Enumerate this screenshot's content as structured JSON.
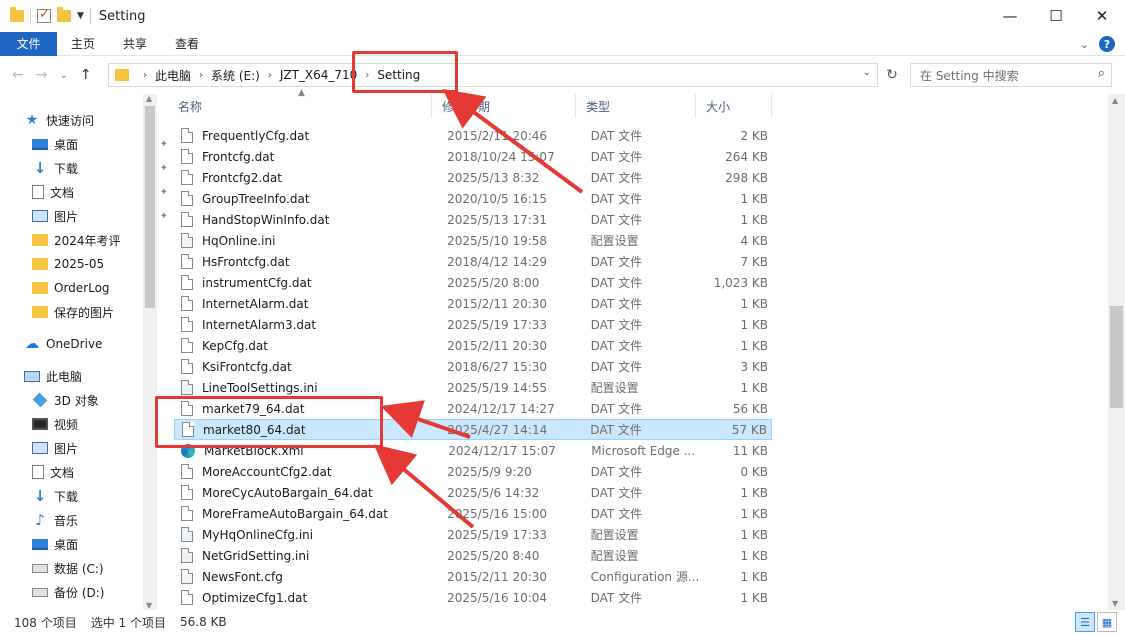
{
  "window": {
    "title": "Setting",
    "minimize": "—",
    "maximize": "☐",
    "close": "✕"
  },
  "ribbon": {
    "tabs": [
      "文件",
      "主页",
      "共享",
      "查看"
    ],
    "collapse_glyph": "⌄",
    "help_glyph": "?"
  },
  "address": {
    "back": "←",
    "forward": "→",
    "recent": "⌄",
    "up": "↑",
    "breadcrumb": [
      "此电脑",
      "系统 (E:)",
      "JZT_X64_710",
      "Setting"
    ],
    "search_placeholder": "在 Setting 中搜索"
  },
  "nav": {
    "items": [
      {
        "label": "快速访问",
        "icon": "star-icon"
      },
      {
        "label": "桌面",
        "icon": "desktop-icon",
        "pinned": true
      },
      {
        "label": "下载",
        "icon": "download-icon",
        "pinned": true
      },
      {
        "label": "文档",
        "icon": "document-icon",
        "pinned": true
      },
      {
        "label": "图片",
        "icon": "picture-icon",
        "pinned": true
      },
      {
        "label": "2024年考评",
        "icon": "folder-icon"
      },
      {
        "label": "2025-05",
        "icon": "folder-icon"
      },
      {
        "label": "OrderLog",
        "icon": "folder-icon"
      },
      {
        "label": "保存的图片",
        "icon": "folder-icon"
      },
      {
        "label": "OneDrive",
        "icon": "cloud-icon"
      },
      {
        "label": "此电脑",
        "icon": "computer-icon"
      },
      {
        "label": "3D 对象",
        "icon": "cube-icon"
      },
      {
        "label": "视频",
        "icon": "video-icon"
      },
      {
        "label": "图片",
        "icon": "picture-icon"
      },
      {
        "label": "文档",
        "icon": "document-icon"
      },
      {
        "label": "下载",
        "icon": "download-icon"
      },
      {
        "label": "音乐",
        "icon": "music-icon"
      },
      {
        "label": "桌面",
        "icon": "desktop-icon"
      },
      {
        "label": "数据 (C:)",
        "icon": "drive-icon"
      },
      {
        "label": "备份 (D:)",
        "icon": "drive-icon"
      }
    ]
  },
  "columns": {
    "name": "名称",
    "date": "修改日期",
    "type": "类型",
    "size": "大小"
  },
  "files": [
    {
      "name": "FrequentlyCfg.dat",
      "date": "2015/2/11 20:46",
      "type": "DAT 文件",
      "size": "2 KB",
      "icon": "file"
    },
    {
      "name": "Frontcfg.dat",
      "date": "2018/10/24 15:07",
      "type": "DAT 文件",
      "size": "264 KB",
      "icon": "file"
    },
    {
      "name": "Frontcfg2.dat",
      "date": "2025/5/13 8:32",
      "type": "DAT 文件",
      "size": "298 KB",
      "icon": "file"
    },
    {
      "name": "GroupTreeInfo.dat",
      "date": "2020/10/5 16:15",
      "type": "DAT 文件",
      "size": "1 KB",
      "icon": "file"
    },
    {
      "name": "HandStopWinInfo.dat",
      "date": "2025/5/13 17:31",
      "type": "DAT 文件",
      "size": "1 KB",
      "icon": "file"
    },
    {
      "name": "HqOnline.ini",
      "date": "2025/5/10 19:58",
      "type": "配置设置",
      "size": "4 KB",
      "icon": "ini"
    },
    {
      "name": "HsFrontcfg.dat",
      "date": "2018/4/12 14:29",
      "type": "DAT 文件",
      "size": "7 KB",
      "icon": "file"
    },
    {
      "name": "instrumentCfg.dat",
      "date": "2025/5/20 8:00",
      "type": "DAT 文件",
      "size": "1,023 KB",
      "icon": "file"
    },
    {
      "name": "InternetAlarm.dat",
      "date": "2015/2/11 20:30",
      "type": "DAT 文件",
      "size": "1 KB",
      "icon": "file"
    },
    {
      "name": "InternetAlarm3.dat",
      "date": "2025/5/19 17:33",
      "type": "DAT 文件",
      "size": "1 KB",
      "icon": "file"
    },
    {
      "name": "KepCfg.dat",
      "date": "2015/2/11 20:30",
      "type": "DAT 文件",
      "size": "1 KB",
      "icon": "file"
    },
    {
      "name": "KsiFrontcfg.dat",
      "date": "2018/6/27 15:30",
      "type": "DAT 文件",
      "size": "3 KB",
      "icon": "file"
    },
    {
      "name": "LineToolSettings.ini",
      "date": "2025/5/19 14:55",
      "type": "配置设置",
      "size": "1 KB",
      "icon": "ini"
    },
    {
      "name": "market79_64.dat",
      "date": "2024/12/17 14:27",
      "type": "DAT 文件",
      "size": "56 KB",
      "icon": "file"
    },
    {
      "name": "market80_64.dat",
      "date": "2025/4/27 14:14",
      "type": "DAT 文件",
      "size": "57 KB",
      "icon": "file",
      "selected": true
    },
    {
      "name": "MarketBlock.xml",
      "date": "2024/12/17 15:07",
      "type": "Microsoft Edge ...",
      "size": "11 KB",
      "icon": "edge"
    },
    {
      "name": "MoreAccountCfg2.dat",
      "date": "2025/5/9 9:20",
      "type": "DAT 文件",
      "size": "0 KB",
      "icon": "file"
    },
    {
      "name": "MoreCycAutoBargain_64.dat",
      "date": "2025/5/6 14:32",
      "type": "DAT 文件",
      "size": "1 KB",
      "icon": "file"
    },
    {
      "name": "MoreFrameAutoBargain_64.dat",
      "date": "2025/5/16 15:00",
      "type": "DAT 文件",
      "size": "1 KB",
      "icon": "file"
    },
    {
      "name": "MyHqOnlineCfg.ini",
      "date": "2025/5/19 17:33",
      "type": "配置设置",
      "size": "1 KB",
      "icon": "ini"
    },
    {
      "name": "NetGridSetting.ini",
      "date": "2025/5/20 8:40",
      "type": "配置设置",
      "size": "1 KB",
      "icon": "ini"
    },
    {
      "name": "NewsFont.cfg",
      "date": "2015/2/11 20:30",
      "type": "Configuration 源...",
      "size": "1 KB",
      "icon": "cfg"
    },
    {
      "name": "OptimizeCfg1.dat",
      "date": "2025/5/16 10:04",
      "type": "DAT 文件",
      "size": "1 KB",
      "icon": "file"
    }
  ],
  "status": {
    "count": "108 个项目",
    "selection": "选中 1 个项目",
    "size": "56.8 KB"
  },
  "annotation_color": "#e53935"
}
